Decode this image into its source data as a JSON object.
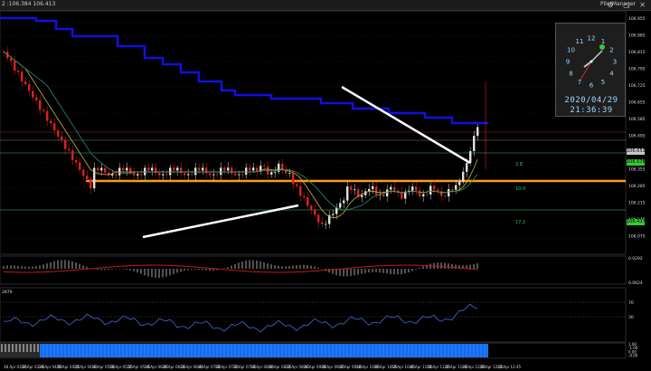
{
  "window": {
    "title_text": "2 :106.384 106.413",
    "plugin_label": "PilotManager",
    "controls_text": "⚙ ▢ ✕"
  },
  "colors": {
    "background": "#000000",
    "resistance_step": "#1010e0",
    "support_line": "#ff9a1f",
    "trend_lines": "#ffffff",
    "candle_up": "#e0e0e0",
    "candle_down": "#e02020",
    "ma_fast": "#c8b24a",
    "ma_slow": "#2a8f6a",
    "histogram": "#cccccc",
    "signal_line": "#c81818",
    "rsi_line": "#3c6fd6",
    "bottom_bar": "#1e78ff"
  },
  "clock": {
    "date": "2020/04/29",
    "time": "21:36:39",
    "numerals": [
      "12",
      "1",
      "2",
      "3",
      "4",
      "5",
      "6",
      "7",
      "8",
      "9",
      "10",
      "11"
    ]
  },
  "price_tags": [
    {
      "name": "tag-upper",
      "label": "106.653",
      "bg": "#c8c8c8"
    },
    {
      "name": "tag-current",
      "label": "106.578",
      "bg": "#33cc33"
    },
    {
      "name": "tag-lower",
      "label": "106.437",
      "bg": "#33cc33"
    }
  ],
  "level_labels": {
    "l1": "2.8",
    "l2": "10.0",
    "l3": "17.1"
  },
  "chart_data": {
    "type": "candlestick",
    "y_axis_labels": [
      "106.955",
      "106.885",
      "106.815",
      "106.795",
      "106.725",
      "106.655",
      "106.585",
      "106.495",
      "106.425",
      "106.355",
      "106.285",
      "106.215",
      "106.145",
      "106.075"
    ],
    "x_axis_labels": [
      "28 Apr 03:25",
      "28 Apr 03:45",
      "28 Apr 04:05",
      "28 Apr 04:25",
      "28 Apr 04:45",
      "28 Apr 05:05",
      "28 Apr 05:25",
      "28 Apr 05:45",
      "28 Apr 06:05",
      "28 Apr 06:25",
      "28 Apr 06:45",
      "28 Apr 07:05",
      "28 Apr 07:25",
      "28 Apr 07:45",
      "28 Apr 08:05",
      "28 Apr 08:25",
      "28 Apr 08:45",
      "28 Apr 09:05",
      "28 Apr 09:25",
      "28 Apr 09:45",
      "28 Apr 10:05",
      "28 Apr 10:25",
      "28 Apr 10:45",
      "28 Apr 11:05",
      "28 Apr 11:25",
      "28 Apr 11:45",
      "28 Apr 12:05",
      "28 Apr 12:25",
      "28 Apr 12:45"
    ],
    "osc1_labels": [
      "0.0292",
      "0.0624"
    ],
    "osc2_label_left": "2879",
    "osc2_labels": [
      "70",
      "30"
    ],
    "bottom_labels": [
      "1.00",
      "-1.00",
      "0.00",
      "-4.00"
    ]
  }
}
